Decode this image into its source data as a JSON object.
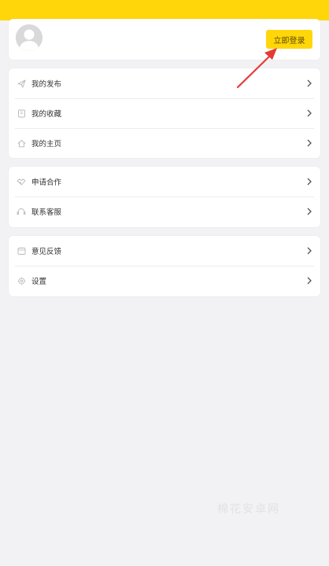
{
  "colors": {
    "accent": "#ffd60a",
    "background": "#f2f2f4",
    "card": "#ffffff",
    "annotation_arrow": "#e53935"
  },
  "profile": {
    "login_button": "立即登录",
    "avatar_icon": "default-user-avatar"
  },
  "menu_groups": [
    {
      "items": [
        {
          "label": "我的发布",
          "icon": "send-icon"
        },
        {
          "label": "我的收藏",
          "icon": "bookmark-icon"
        },
        {
          "label": "我的主页",
          "icon": "home-icon"
        }
      ]
    },
    {
      "items": [
        {
          "label": "申请合作",
          "icon": "handshake-icon"
        },
        {
          "label": "联系客服",
          "icon": "headset-icon"
        }
      ]
    },
    {
      "items": [
        {
          "label": "意见反馈",
          "icon": "feedback-icon"
        },
        {
          "label": "设置",
          "icon": "gear-icon"
        }
      ]
    }
  ],
  "watermark": "棉花安卓网"
}
